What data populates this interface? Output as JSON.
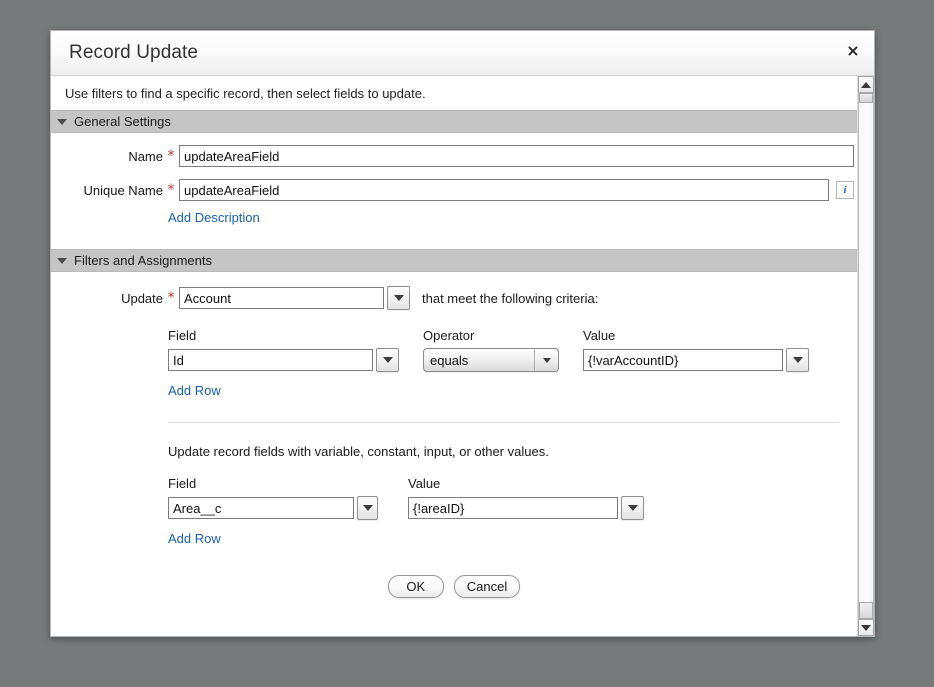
{
  "dialog": {
    "title": "Record Update",
    "close_label": "×",
    "intro": "Use filters to find a specific record, then select fields to update."
  },
  "sections": {
    "general": {
      "header": "General Settings",
      "name_label": "Name",
      "name_value": "updateAreaField",
      "unique_name_label": "Unique Name",
      "unique_name_value": "updateAreaField",
      "required_marker": "*",
      "info_icon_glyph": "i",
      "add_description_link": "Add Description"
    },
    "filters": {
      "header": "Filters and Assignments",
      "update_label": "Update",
      "update_value": "Account",
      "criteria_text": "that meet the following criteria:",
      "columns": {
        "field": "Field",
        "operator": "Operator",
        "value": "Value"
      },
      "criteria_rows": [
        {
          "field": "Id",
          "operator": "equals",
          "value": "{!varAccountID}"
        }
      ],
      "add_row_link": "Add Row",
      "delete_icon_name": "trash-icon"
    },
    "assignments": {
      "note": "Update record fields with variable, constant, input, or other values.",
      "columns": {
        "field": "Field",
        "value": "Value"
      },
      "rows": [
        {
          "field": "Area__c",
          "value": "{!areaID}"
        }
      ],
      "add_row_link": "Add Row"
    }
  },
  "footer": {
    "ok_label": "OK",
    "cancel_label": "Cancel"
  },
  "scrollbar": {
    "up_arrow": "▲",
    "down_arrow": "▼"
  },
  "colors": {
    "backdrop": "#767a7b",
    "section_header": "#c5c5c5",
    "link": "#1b60b5",
    "required": "#c23934"
  }
}
